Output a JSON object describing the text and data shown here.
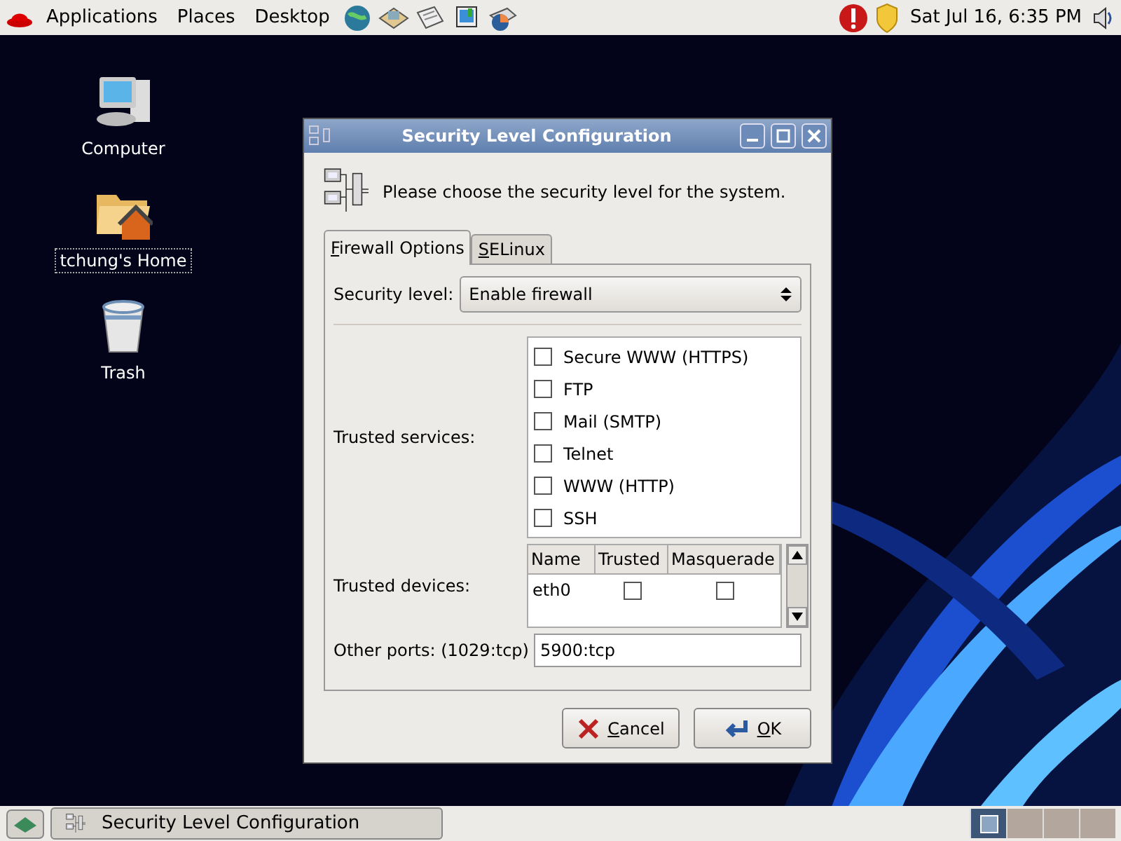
{
  "top_panel": {
    "menus": [
      "Applications",
      "Places",
      "Desktop"
    ],
    "clock": "Sat Jul 16,  6:35 PM"
  },
  "desktop_icons": [
    {
      "label": "Computer",
      "kind": "computer",
      "selected": false
    },
    {
      "label": "tchung's Home",
      "kind": "home",
      "selected": true
    },
    {
      "label": "Trash",
      "kind": "trash",
      "selected": false
    }
  ],
  "dialog": {
    "title": "Security Level Configuration",
    "intro": "Please choose the security level for the system.",
    "tabs": [
      {
        "label": "Firewall Options",
        "selected": true
      },
      {
        "label": "SELinux",
        "selected": false
      }
    ],
    "security_level": {
      "label": "Security level:",
      "value": "Enable firewall"
    },
    "trusted_services": {
      "label": "Trusted services:",
      "items": [
        {
          "label": "Secure WWW (HTTPS)",
          "checked": false
        },
        {
          "label": "FTP",
          "checked": false
        },
        {
          "label": "Mail (SMTP)",
          "checked": false
        },
        {
          "label": "Telnet",
          "checked": false
        },
        {
          "label": "WWW (HTTP)",
          "checked": false
        },
        {
          "label": "SSH",
          "checked": false
        }
      ]
    },
    "trusted_devices": {
      "label": "Trusted devices:",
      "columns": [
        "Name",
        "Trusted",
        "Masquerade"
      ],
      "rows": [
        {
          "name": "eth0",
          "trusted": false,
          "masquerade": false
        }
      ]
    },
    "other_ports": {
      "label": "Other ports: (1029:tcp)",
      "value": "5900:tcp"
    },
    "buttons": [
      "Cancel",
      "OK"
    ]
  },
  "taskbar": {
    "tasks": [
      {
        "label": "Security Level Configuration"
      }
    ],
    "workspaces": [
      {
        "selected": true
      },
      {
        "selected": false
      },
      {
        "selected": false
      },
      {
        "selected": false
      }
    ]
  }
}
